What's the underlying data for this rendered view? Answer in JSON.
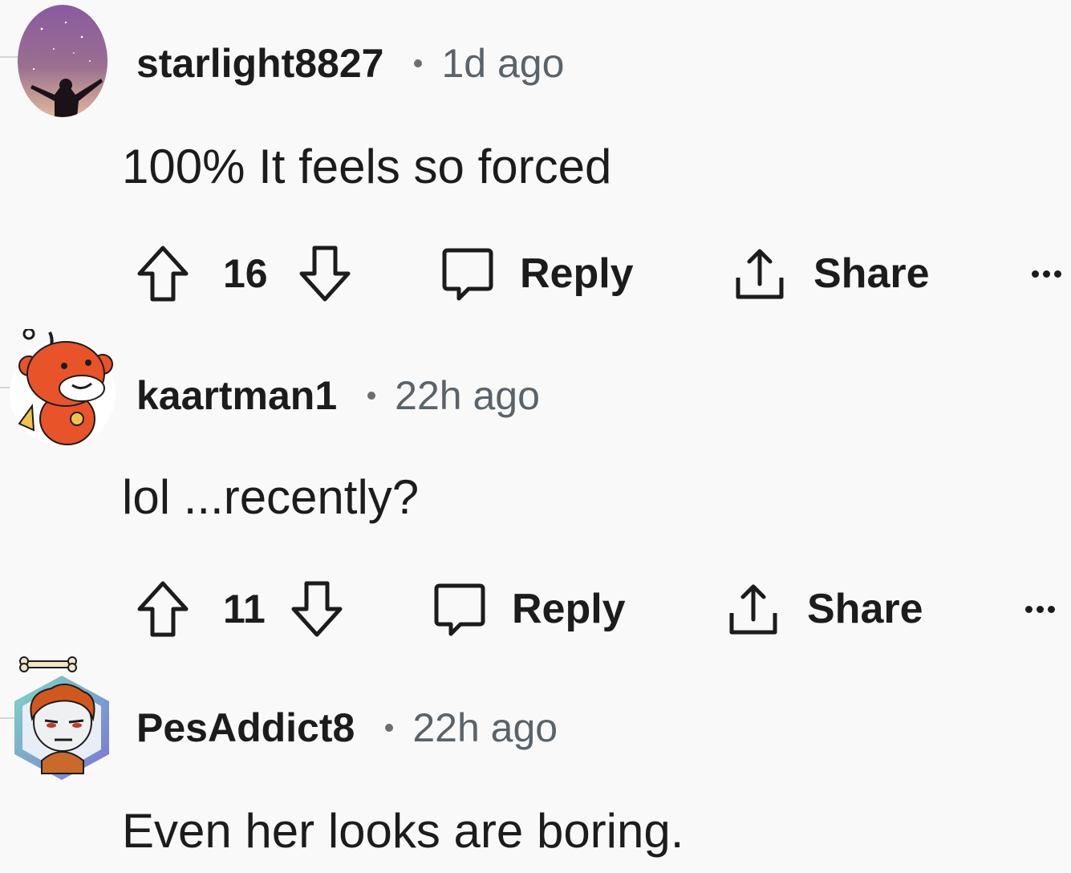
{
  "comments": [
    {
      "username": "starlight8827",
      "time": "1d ago",
      "body": "100%  It feels so forced",
      "votes": "16",
      "reply_label": "Reply",
      "share_label": "Share",
      "avatar_icon": "night-sky-silhouette-avatar"
    },
    {
      "username": "kaartman1",
      "time": "22h ago",
      "body": "lol ...recently?",
      "votes": "11",
      "reply_label": "Reply",
      "share_label": "Share",
      "avatar_icon": "snoo-bear-avatar"
    },
    {
      "username": "PesAddict8",
      "time": "22h ago",
      "body": "Even her looks are boring.",
      "avatar_icon": "snoo-redhead-hex-avatar"
    }
  ],
  "icons": {
    "upvote": "arrow-up-outline-icon",
    "downvote": "arrow-down-outline-icon",
    "reply": "speech-bubble-icon",
    "share": "share-upload-icon",
    "more": "overflow-dots-icon"
  },
  "colors": {
    "background": "#f9f9f9",
    "text": "#1c1c1c",
    "meta_text": "#5a6369"
  }
}
